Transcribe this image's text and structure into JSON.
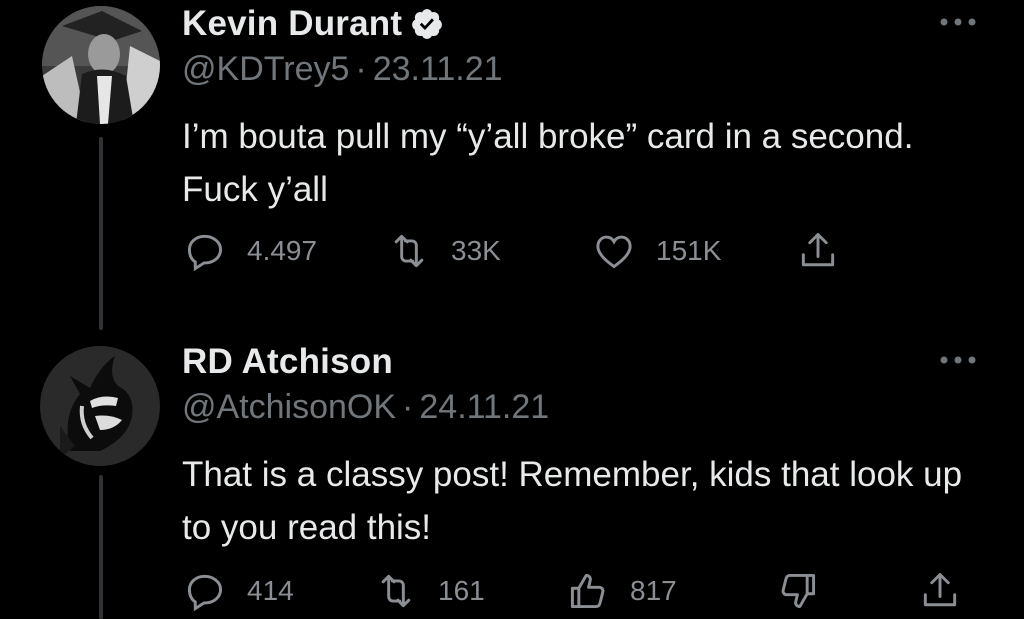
{
  "tweets": [
    {
      "display_name": "Kevin Durant",
      "handle": "@KDTrey5",
      "separator": "·",
      "date": "23.11.21",
      "text": "I’m bouta pull my “y’all broke” card in a second. Fuck y’all",
      "verified": true,
      "avatar_icon": "person-avatar",
      "actions": {
        "reply_count": "4.497",
        "retweet_count": "33K",
        "like_count": "151K"
      },
      "icons": [
        "reply-icon",
        "retweet-icon",
        "heart-icon",
        "share-icon",
        "more-icon"
      ]
    },
    {
      "display_name": "RD Atchison",
      "handle": "@AtchisonOK",
      "separator": "·",
      "date": "24.11.21",
      "text": "That is a classy post!  Remember, kids that look up to you read this!",
      "verified": false,
      "avatar_icon": "blue-devil-logo",
      "actions": {
        "reply_count": "414",
        "retweet_count": "161",
        "upvote_count": "817"
      },
      "icons": [
        "reply-icon",
        "retweet-icon",
        "thumbs-up-icon",
        "thumbs-down-icon",
        "share-icon",
        "more-icon"
      ]
    }
  ],
  "colors": {
    "background": "#000000",
    "primary_text": "#e7e9ea",
    "secondary_text": "#71767b",
    "thread_line": "#2f3336"
  }
}
